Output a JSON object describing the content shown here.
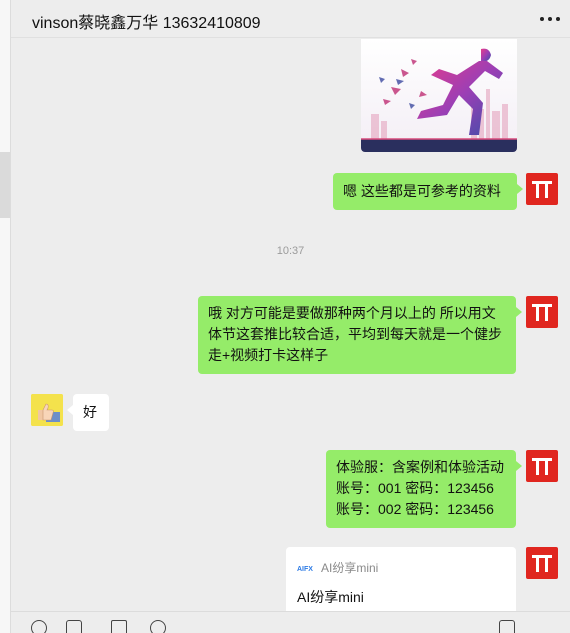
{
  "header": {
    "title": "vinson蔡晓鑫万华 13632410809"
  },
  "messages": {
    "m1_text": "嗯  这些都是可参考的资料",
    "timestamp": "10:37",
    "m2_line1": "哦 对方可能是要做那种两个月以上的   所以用文",
    "m2_line2": "体节这套推比较合适，平均到每天就是一个健步",
    "m2_line3": "走+视频打卡这样子",
    "reply_text": "好",
    "m3_line1": "体验服：含案例和体验活动",
    "m3_line2": "账号：001  密码：123456",
    "m3_line3": "账号：002  密码：123456",
    "mini_source": "AI纷享mini",
    "mini_title": "AI纷享mini"
  },
  "colors": {
    "my_bubble": "#95ec69",
    "other_bubble": "#ffffff",
    "avatar_red": "#e0261f",
    "background": "#ededed"
  },
  "icons": {
    "header_more": "more-dots-icon",
    "my_avatar": "pi-logo-avatar",
    "contact_avatar": "thumbs-up-avatar"
  }
}
